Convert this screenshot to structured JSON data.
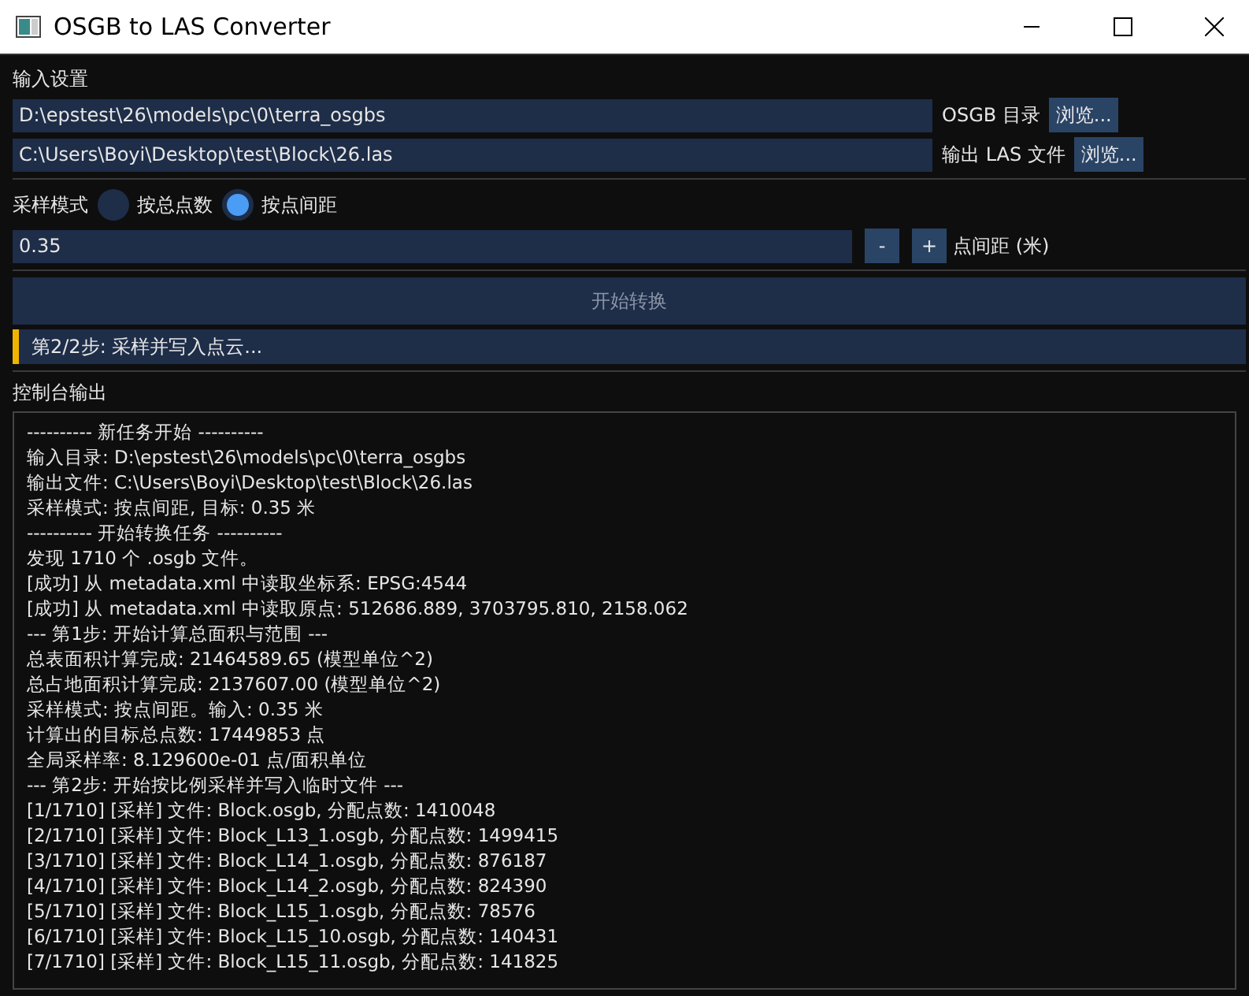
{
  "window": {
    "title": "OSGB to LAS Converter"
  },
  "input_settings": {
    "title": "输入设置",
    "rows": [
      {
        "value": "D:\\epstest\\26\\models\\pc\\0\\terra_osgbs",
        "label": "OSGB 目录",
        "button": "浏览..."
      },
      {
        "value": "C:\\Users\\Boyi\\Desktop\\test\\Block\\26.las",
        "label": "输出 LAS 文件",
        "button": "浏览..."
      }
    ]
  },
  "sampling": {
    "label": "采样模式",
    "options": [
      {
        "label": "按总点数",
        "selected": false
      },
      {
        "label": "按点间距",
        "selected": true
      }
    ],
    "value": "0.35",
    "minus": "-",
    "plus": "+",
    "unit_label": "点间距 (米)"
  },
  "start_button": {
    "label": "开始转换",
    "disabled": true
  },
  "status": "第2/2步: 采样并写入点云...",
  "console": {
    "title": "控制台输出",
    "lines": [
      "---------- 新任务开始 ----------",
      "输入目录: D:\\epstest\\26\\models\\pc\\0\\terra_osgbs",
      "输出文件: C:\\Users\\Boyi\\Desktop\\test\\Block\\26.las",
      "采样模式: 按点间距, 目标: 0.35 米",
      "---------- 开始转换任务 ----------",
      "发现 1710 个 .osgb 文件。",
      "[成功] 从 metadata.xml 中读取坐标系: EPSG:4544",
      "[成功] 从 metadata.xml 中读取原点: 512686.889, 3703795.810, 2158.062",
      "--- 第1步: 开始计算总面积与范围 ---",
      "总表面积计算完成: 21464589.65 (模型单位^2)",
      "总占地面积计算完成: 2137607.00 (模型单位^2)",
      "采样模式: 按点间距。输入: 0.35 米",
      "计算出的目标总点数: 17449853 点",
      "全局采样率: 8.129600e-01 点/面积单位",
      "--- 第2步: 开始按比例采样并写入临时文件 ---",
      "[1/1710] [采样] 文件: Block.osgb, 分配点数: 1410048",
      "[2/1710] [采样] 文件: Block_L13_1.osgb, 分配点数: 1499415",
      "[3/1710] [采样] 文件: Block_L14_1.osgb, 分配点数: 876187",
      "[4/1710] [采样] 文件: Block_L14_2.osgb, 分配点数: 824390",
      "[5/1710] [采样] 文件: Block_L15_1.osgb, 分配点数: 78576",
      "[6/1710] [采样] 文件: Block_L15_10.osgb, 分配点数: 140431",
      "[7/1710] [采样] 文件: Block_L15_11.osgb, 分配点数: 141825"
    ]
  }
}
